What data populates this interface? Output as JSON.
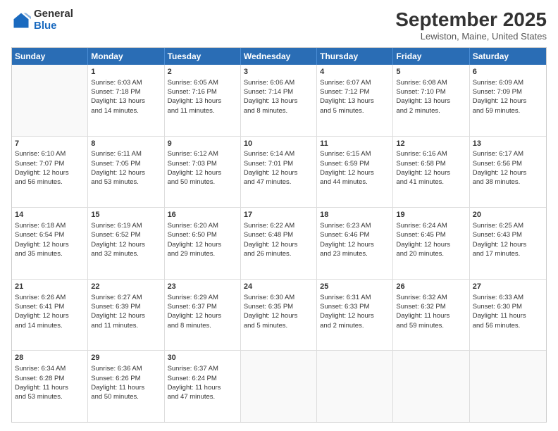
{
  "logo": {
    "general": "General",
    "blue": "Blue"
  },
  "title": "September 2025",
  "subtitle": "Lewiston, Maine, United States",
  "days": [
    "Sunday",
    "Monday",
    "Tuesday",
    "Wednesday",
    "Thursday",
    "Friday",
    "Saturday"
  ],
  "weeks": [
    [
      {
        "day": "",
        "info": ""
      },
      {
        "day": "1",
        "info": "Sunrise: 6:03 AM\nSunset: 7:18 PM\nDaylight: 13 hours\nand 14 minutes."
      },
      {
        "day": "2",
        "info": "Sunrise: 6:05 AM\nSunset: 7:16 PM\nDaylight: 13 hours\nand 11 minutes."
      },
      {
        "day": "3",
        "info": "Sunrise: 6:06 AM\nSunset: 7:14 PM\nDaylight: 13 hours\nand 8 minutes."
      },
      {
        "day": "4",
        "info": "Sunrise: 6:07 AM\nSunset: 7:12 PM\nDaylight: 13 hours\nand 5 minutes."
      },
      {
        "day": "5",
        "info": "Sunrise: 6:08 AM\nSunset: 7:10 PM\nDaylight: 13 hours\nand 2 minutes."
      },
      {
        "day": "6",
        "info": "Sunrise: 6:09 AM\nSunset: 7:09 PM\nDaylight: 12 hours\nand 59 minutes."
      }
    ],
    [
      {
        "day": "7",
        "info": "Sunrise: 6:10 AM\nSunset: 7:07 PM\nDaylight: 12 hours\nand 56 minutes."
      },
      {
        "day": "8",
        "info": "Sunrise: 6:11 AM\nSunset: 7:05 PM\nDaylight: 12 hours\nand 53 minutes."
      },
      {
        "day": "9",
        "info": "Sunrise: 6:12 AM\nSunset: 7:03 PM\nDaylight: 12 hours\nand 50 minutes."
      },
      {
        "day": "10",
        "info": "Sunrise: 6:14 AM\nSunset: 7:01 PM\nDaylight: 12 hours\nand 47 minutes."
      },
      {
        "day": "11",
        "info": "Sunrise: 6:15 AM\nSunset: 6:59 PM\nDaylight: 12 hours\nand 44 minutes."
      },
      {
        "day": "12",
        "info": "Sunrise: 6:16 AM\nSunset: 6:58 PM\nDaylight: 12 hours\nand 41 minutes."
      },
      {
        "day": "13",
        "info": "Sunrise: 6:17 AM\nSunset: 6:56 PM\nDaylight: 12 hours\nand 38 minutes."
      }
    ],
    [
      {
        "day": "14",
        "info": "Sunrise: 6:18 AM\nSunset: 6:54 PM\nDaylight: 12 hours\nand 35 minutes."
      },
      {
        "day": "15",
        "info": "Sunrise: 6:19 AM\nSunset: 6:52 PM\nDaylight: 12 hours\nand 32 minutes."
      },
      {
        "day": "16",
        "info": "Sunrise: 6:20 AM\nSunset: 6:50 PM\nDaylight: 12 hours\nand 29 minutes."
      },
      {
        "day": "17",
        "info": "Sunrise: 6:22 AM\nSunset: 6:48 PM\nDaylight: 12 hours\nand 26 minutes."
      },
      {
        "day": "18",
        "info": "Sunrise: 6:23 AM\nSunset: 6:46 PM\nDaylight: 12 hours\nand 23 minutes."
      },
      {
        "day": "19",
        "info": "Sunrise: 6:24 AM\nSunset: 6:45 PM\nDaylight: 12 hours\nand 20 minutes."
      },
      {
        "day": "20",
        "info": "Sunrise: 6:25 AM\nSunset: 6:43 PM\nDaylight: 12 hours\nand 17 minutes."
      }
    ],
    [
      {
        "day": "21",
        "info": "Sunrise: 6:26 AM\nSunset: 6:41 PM\nDaylight: 12 hours\nand 14 minutes."
      },
      {
        "day": "22",
        "info": "Sunrise: 6:27 AM\nSunset: 6:39 PM\nDaylight: 12 hours\nand 11 minutes."
      },
      {
        "day": "23",
        "info": "Sunrise: 6:29 AM\nSunset: 6:37 PM\nDaylight: 12 hours\nand 8 minutes."
      },
      {
        "day": "24",
        "info": "Sunrise: 6:30 AM\nSunset: 6:35 PM\nDaylight: 12 hours\nand 5 minutes."
      },
      {
        "day": "25",
        "info": "Sunrise: 6:31 AM\nSunset: 6:33 PM\nDaylight: 12 hours\nand 2 minutes."
      },
      {
        "day": "26",
        "info": "Sunrise: 6:32 AM\nSunset: 6:32 PM\nDaylight: 11 hours\nand 59 minutes."
      },
      {
        "day": "27",
        "info": "Sunrise: 6:33 AM\nSunset: 6:30 PM\nDaylight: 11 hours\nand 56 minutes."
      }
    ],
    [
      {
        "day": "28",
        "info": "Sunrise: 6:34 AM\nSunset: 6:28 PM\nDaylight: 11 hours\nand 53 minutes."
      },
      {
        "day": "29",
        "info": "Sunrise: 6:36 AM\nSunset: 6:26 PM\nDaylight: 11 hours\nand 50 minutes."
      },
      {
        "day": "30",
        "info": "Sunrise: 6:37 AM\nSunset: 6:24 PM\nDaylight: 11 hours\nand 47 minutes."
      },
      {
        "day": "",
        "info": ""
      },
      {
        "day": "",
        "info": ""
      },
      {
        "day": "",
        "info": ""
      },
      {
        "day": "",
        "info": ""
      }
    ]
  ]
}
